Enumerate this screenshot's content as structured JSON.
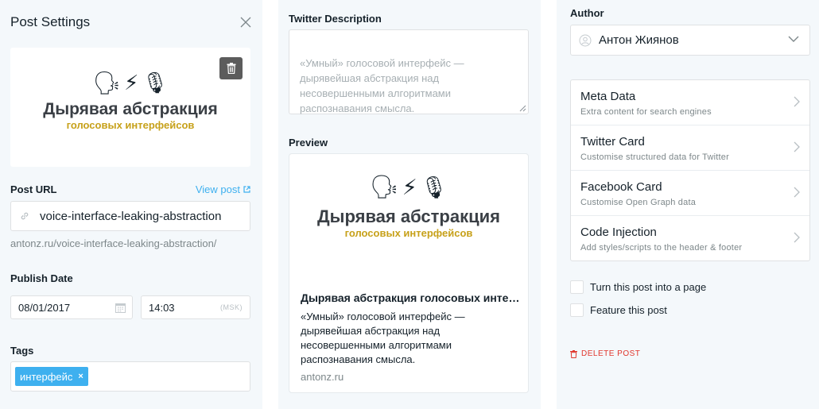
{
  "settings": {
    "title": "Post Settings",
    "post_url_label": "Post URL",
    "view_post_label": "View post",
    "slug": "voice-interface-leaking-abstraction",
    "full_url": "antonz.ru/voice-interface-leaking-abstraction/",
    "publish_date_label": "Publish Date",
    "date": "08/01/2017",
    "time": "14:03",
    "timezone": "(MSK)",
    "tags_label": "Tags",
    "tags": [
      "интерфейс"
    ],
    "tag_remove_glyph": "×"
  },
  "feature_image": {
    "emoji_speaker": "🗣",
    "emoji_bolt": "⚡",
    "emoji_mic": "🎙",
    "title": "Дырявая абстракция",
    "subtitle": "голосовых интерфейсов"
  },
  "twitter": {
    "description_label": "Twitter Description",
    "description_placeholder": "«Умный» голосовой интерфейс —\nдырявейшая абстракция над\nнесовершенными алгоритмами\nраспознавания смысла.",
    "preview_label": "Preview",
    "preview_title": "Дырявая абстракция голосовых интерфейсов",
    "preview_desc": "«Умный» голосовой интерфейс —\nдырявейшая абстракция над\nнесовершенными алгоритмами\nраспознавания смысла.",
    "preview_domain": "antonz.ru"
  },
  "author": {
    "label": "Author",
    "name": "Антон Жиянов"
  },
  "menu": [
    {
      "title": "Meta Data",
      "desc": "Extra content for search engines"
    },
    {
      "title": "Twitter Card",
      "desc": "Customise structured data for Twitter"
    },
    {
      "title": "Facebook Card",
      "desc": "Customise Open Graph data"
    },
    {
      "title": "Code Injection",
      "desc": "Add styles/scripts to the header & footer"
    }
  ],
  "options": {
    "page_toggle": "Turn this post into a page",
    "feature_toggle": "Feature this post",
    "delete_label": "DELETE POST"
  },
  "colors": {
    "accent": "#3eb0ef",
    "danger": "#e0352b",
    "panel_bg": "#f4f8fb",
    "logo_gold": "#c7a11a"
  }
}
